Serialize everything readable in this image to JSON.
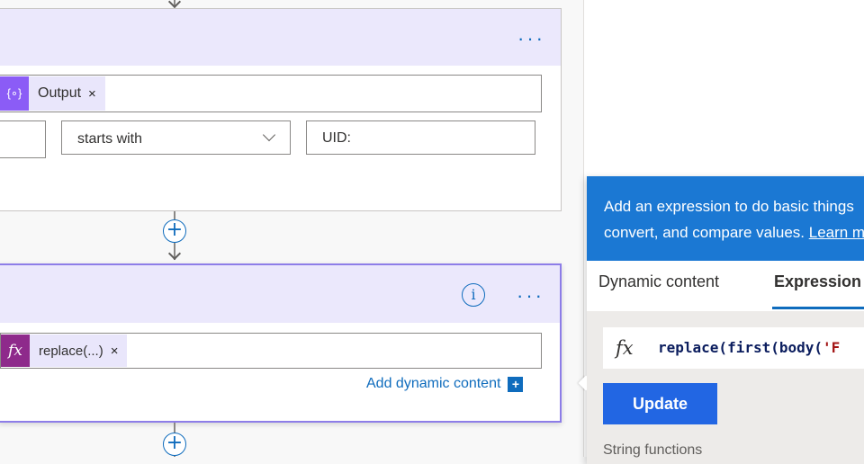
{
  "card1": {
    "more_label": "···",
    "output_token": {
      "icon": "{∘}",
      "label": "Output",
      "remove": "×",
      "icon_color": "#8b5cf6"
    },
    "operator": {
      "value": "starts with"
    },
    "value_field": {
      "value": "UID:"
    }
  },
  "card2": {
    "info_label": "i",
    "more_label": "···",
    "expr_token": {
      "icon": "fx",
      "label": "replace(...)",
      "remove": "×",
      "icon_color": "#8e2a8b"
    },
    "add_dynamic": {
      "label": "Add dynamic content",
      "plus": "+"
    }
  },
  "connector": {
    "plus": "+"
  },
  "popup": {
    "banner_line1": "Add an expression to do basic things",
    "banner_line2_prefix": "convert, and compare values. ",
    "banner_link": "Learn more",
    "tabs": [
      {
        "label": "Dynamic content",
        "active": false
      },
      {
        "label": "Expression",
        "active": true
      }
    ],
    "expression": {
      "fx_label": "fx",
      "code_prefix": "replace(first(body(",
      "code_string": "'F"
    },
    "update_label": "Update",
    "section_label": "String functions"
  },
  "colors": {
    "accent": "#0f6cbd",
    "card_header": "#ebe8fc",
    "banner": "#1b78d3",
    "update_button": "#2266e3"
  }
}
